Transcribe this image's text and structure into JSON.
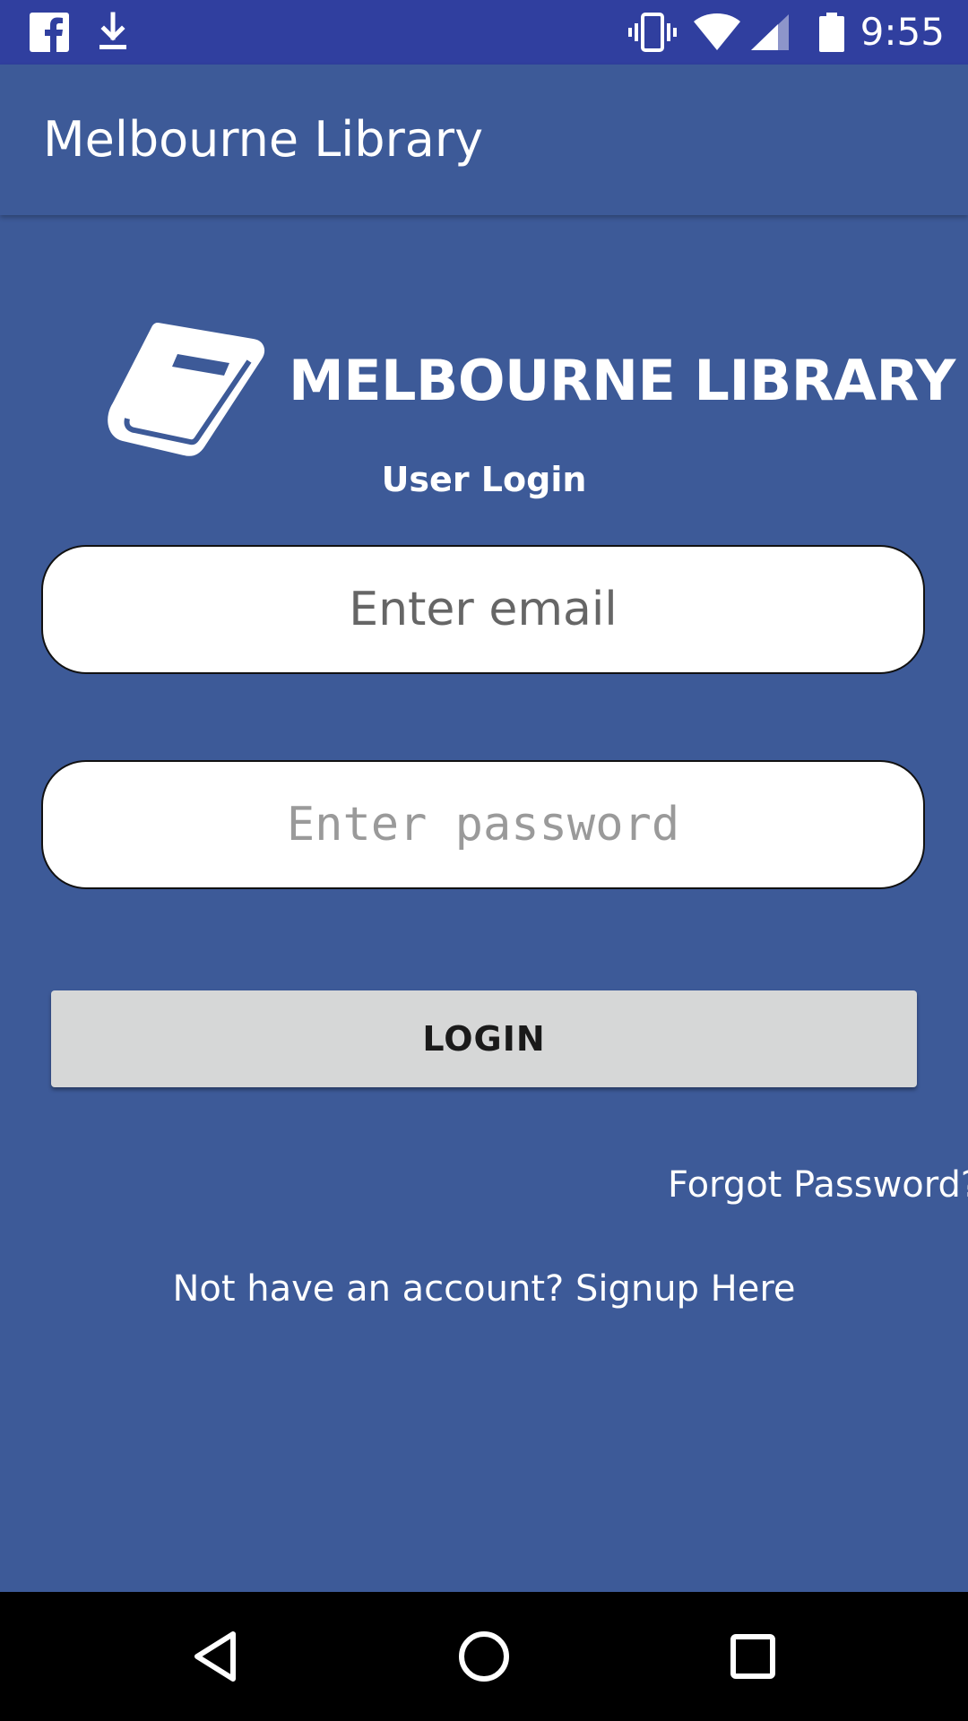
{
  "status_bar": {
    "time": "9:55",
    "left_icons": [
      "facebook-icon",
      "download-icon"
    ],
    "right_icons": [
      "vibrate-icon",
      "wifi-icon",
      "signal-icon",
      "battery-icon"
    ],
    "background": "#303f9f"
  },
  "app_bar": {
    "title": "Melbourne Library"
  },
  "login": {
    "logo_icon": "book-icon",
    "brand_title": "MELBOURNE LIBRARY",
    "subtitle": "User Login",
    "email_placeholder": "Enter email",
    "email_value": "",
    "password_placeholder": "Enter password",
    "password_value": "",
    "login_label": "LOGIN",
    "forgot_label": "Forgot Password?",
    "signup_label": "Not have an account? Signup Here"
  },
  "nav_bar": {
    "icons": [
      "back-icon",
      "home-icon",
      "recents-icon"
    ]
  },
  "colors": {
    "background": "#3d5a98",
    "status_bar": "#303f9f",
    "button": "#d6d7d7",
    "text_on_dark": "#ffffff"
  }
}
